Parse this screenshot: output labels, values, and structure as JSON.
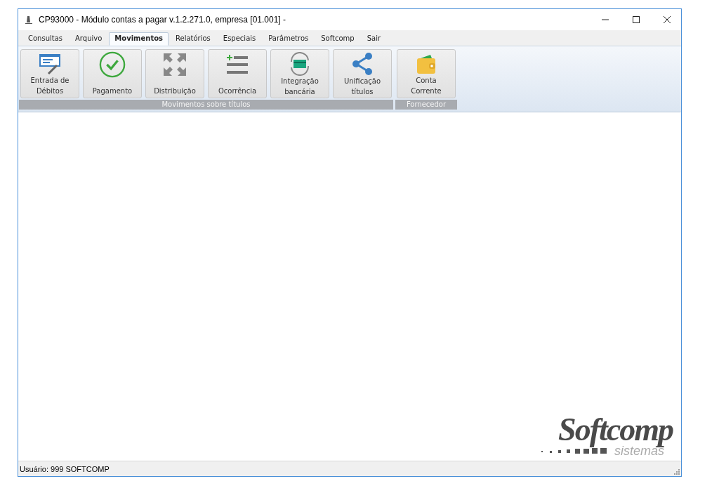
{
  "window": {
    "title": "CP93000 - Módulo contas a pagar v.1.2.271.0, empresa [01.001] -"
  },
  "tabs": [
    {
      "label": "Consultas",
      "selected": false
    },
    {
      "label": "Arquivo",
      "selected": false
    },
    {
      "label": "Movimentos",
      "selected": true
    },
    {
      "label": "Relatórios",
      "selected": false
    },
    {
      "label": "Especiais",
      "selected": false
    },
    {
      "label": "Parâmetros",
      "selected": false
    },
    {
      "label": "Softcomp",
      "selected": false
    },
    {
      "label": "Sair",
      "selected": false
    }
  ],
  "groups": [
    {
      "label": "Movimentos sobre títulos",
      "buttons": [
        {
          "kind": "form",
          "lines": [
            "Entrada de",
            "Débitos"
          ]
        },
        {
          "kind": "check",
          "lines": [
            "Pagamento"
          ]
        },
        {
          "kind": "arrows",
          "lines": [
            "Distribuição"
          ]
        },
        {
          "kind": "list",
          "lines": [
            "Ocorrência"
          ]
        },
        {
          "kind": "sync",
          "lines": [
            "Integração",
            "bancária"
          ]
        },
        {
          "kind": "share",
          "lines": [
            "Unificação",
            "títulos"
          ]
        }
      ]
    },
    {
      "label": "Fornecedor",
      "buttons": [
        {
          "kind": "wallet",
          "lines": [
            "Conta",
            "Corrente"
          ]
        }
      ]
    }
  ],
  "logo": {
    "name": "Softcomp",
    "tagline": "sistemas"
  },
  "status_bar": {
    "user": "Usuário: 999 SOFTCOMP"
  }
}
